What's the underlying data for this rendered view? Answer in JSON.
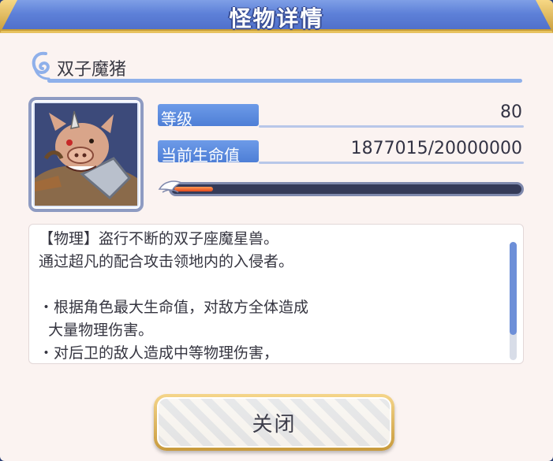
{
  "dialog": {
    "title": "怪物详情",
    "close_label": "关闭"
  },
  "monster": {
    "name": "双子魔猪",
    "portrait_icon": "boar-monster-portrait"
  },
  "stats": {
    "level_label": "等级",
    "level_value": "80",
    "hp_label": "当前生命值",
    "hp_value": "1877015/20000000",
    "hp_fraction": 0.0939
  },
  "description": {
    "text": "【物理】盗行不断的双子座魔星兽。\n通过超凡的配合攻击领地内的入侵者。\n\n・根据角色最大生命值，对敌方全体造成\n  大量物理伤害。\n・对后卫的敌人造成中等物理伤害，\n  大幅度降低攻击速度。"
  },
  "colors": {
    "title_bar": "#5d80d8",
    "accent_gold": "#e7c25f",
    "label_blue": "#4e7fd6",
    "hp_fill": "#e2461b"
  }
}
